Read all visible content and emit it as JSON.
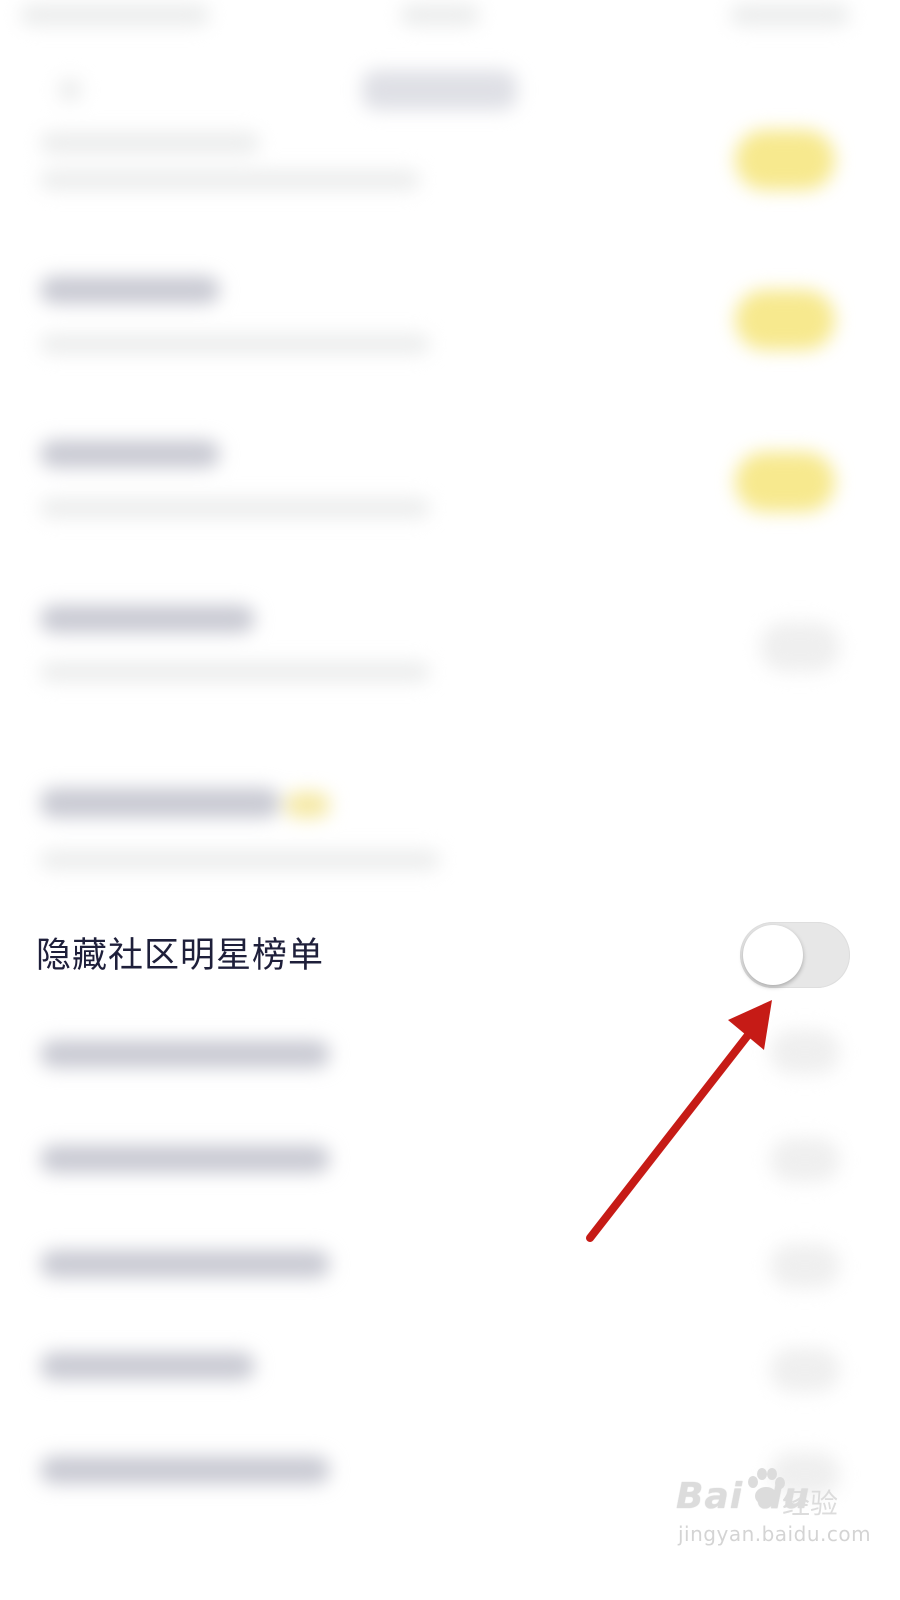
{
  "settings": {
    "focused_row": {
      "label": "隐藏社区明星榜单",
      "toggle_on": false
    }
  },
  "watermark": {
    "logo": "Bai du",
    "sub": "经验",
    "url": "jingyan.baidu.com"
  },
  "colors": {
    "accent_yellow": "#f7e98e",
    "arrow_red": "#c61b16",
    "label_text": "#1e1f3a"
  }
}
